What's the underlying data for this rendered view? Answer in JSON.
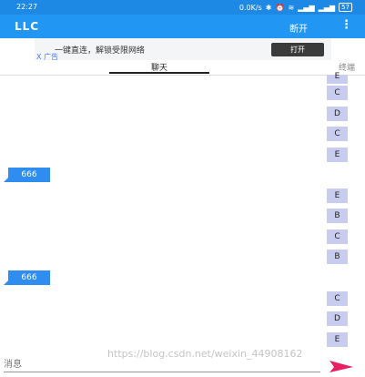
{
  "status_bar": {
    "time": "22:27",
    "speed": "0.0K/s",
    "battery": "57"
  },
  "app_bar": {
    "title": "LLC",
    "disconnect_label": "断开",
    "more_label": "⋮"
  },
  "ad": {
    "text": "一键直连，解锁受限网络",
    "button_label": "打开",
    "ad_mark": "X 广告"
  },
  "tabs": [
    {
      "label": "聊天"
    },
    {
      "label": "终端"
    }
  ],
  "messages": [
    {
      "dir": "in",
      "text": "E"
    },
    {
      "dir": "in",
      "text": "C"
    },
    {
      "dir": "in",
      "text": "D"
    },
    {
      "dir": "in",
      "text": "C"
    },
    {
      "dir": "in",
      "text": "E"
    },
    {
      "dir": "out",
      "text": "666"
    },
    {
      "dir": "in",
      "text": "E"
    },
    {
      "dir": "in",
      "text": "B"
    },
    {
      "dir": "in",
      "text": "C"
    },
    {
      "dir": "in",
      "text": "B"
    },
    {
      "dir": "out",
      "text": "666"
    },
    {
      "dir": "in",
      "text": "C"
    },
    {
      "dir": "in",
      "text": "D"
    },
    {
      "dir": "in",
      "text": "E"
    }
  ],
  "input": {
    "placeholder": "消息",
    "value": ""
  },
  "watermark": "https://blog.csdn.net/weixin_44908162",
  "colors": {
    "primary": "#2196f3",
    "outgoing_bubble": "#2f8df0",
    "incoming_bubble": "#c8cdf0",
    "send_icon": "#e91e63"
  }
}
